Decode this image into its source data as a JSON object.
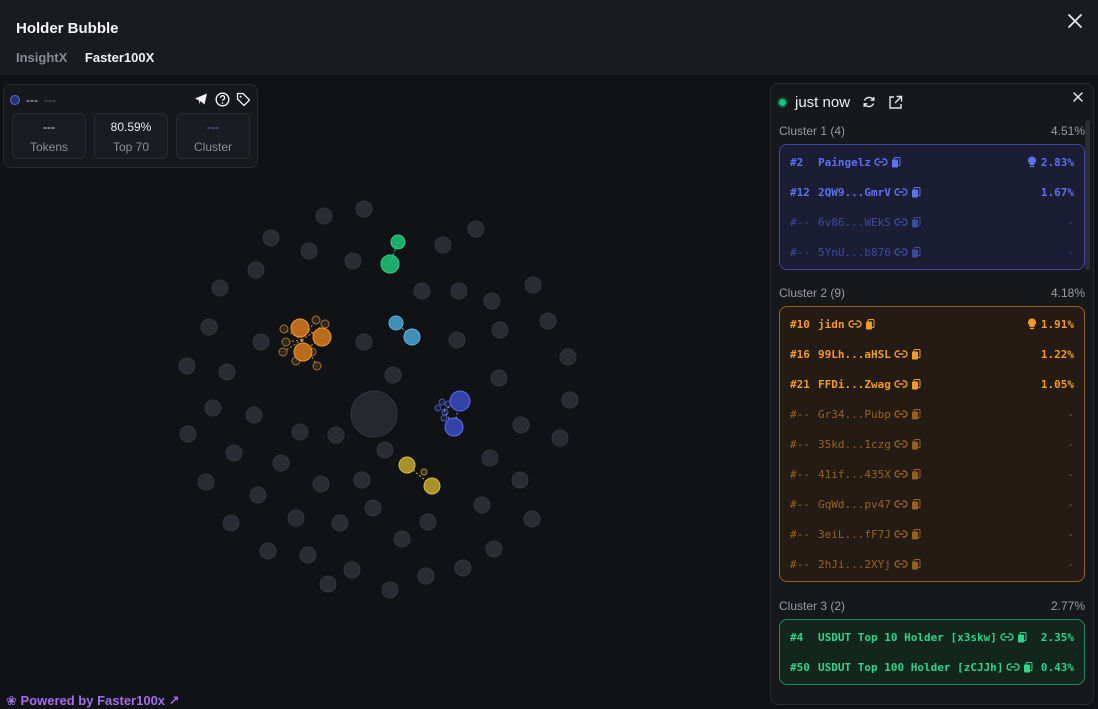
{
  "header": {
    "title": "Holder Bubble",
    "tabs": [
      {
        "label": "InsightX",
        "active": false
      },
      {
        "label": "Faster100X",
        "active": true
      }
    ]
  },
  "token": {
    "name": "---",
    "symbol": "---",
    "stats": [
      {
        "value": "---",
        "label": "Tokens"
      },
      {
        "value": "80.59%",
        "label": "Top 70"
      },
      {
        "value": "---",
        "label": "Cluster"
      }
    ]
  },
  "footer": {
    "powered_by": "Powered by Faster100x"
  },
  "panel": {
    "status": "just now"
  },
  "clusters": [
    {
      "title": "Cluster 1 (4)",
      "pct": "4.51%",
      "color": "#5b72f2",
      "border": "#3b4ba8",
      "bg": "#1a1d33",
      "rows": [
        {
          "rank": "#2",
          "name": "Paingelz",
          "pct": "2.83%",
          "bulb": true,
          "dim": false
        },
        {
          "rank": "#12",
          "name": "2QW9...GmrV",
          "pct": "1.67%",
          "bulb": false,
          "dim": false
        },
        {
          "rank": "#--",
          "name": "6v86...WEkS",
          "pct": "-",
          "bulb": false,
          "dim": true
        },
        {
          "rank": "#--",
          "name": "5YnU...b876",
          "pct": "-",
          "bulb": false,
          "dim": true
        }
      ]
    },
    {
      "title": "Cluster 2 (9)",
      "pct": "4.18%",
      "color": "#f39a2b",
      "border": "#9a5e1b",
      "bg": "#241c14",
      "rows": [
        {
          "rank": "#10",
          "name": "jidn",
          "pct": "1.91%",
          "bulb": true,
          "dim": false
        },
        {
          "rank": "#16",
          "name": "99Lh...aHSL",
          "pct": "1.22%",
          "bulb": false,
          "dim": false
        },
        {
          "rank": "#21",
          "name": "FFDi...Zwag",
          "pct": "1.05%",
          "bulb": false,
          "dim": false
        },
        {
          "rank": "#--",
          "name": "Gr34...Pubp",
          "pct": "-",
          "bulb": false,
          "dim": true
        },
        {
          "rank": "#--",
          "name": "35kd...1czg",
          "pct": "-",
          "bulb": false,
          "dim": true
        },
        {
          "rank": "#--",
          "name": "41if...435X",
          "pct": "-",
          "bulb": false,
          "dim": true
        },
        {
          "rank": "#--",
          "name": "GqWd...pv47",
          "pct": "-",
          "bulb": false,
          "dim": true
        },
        {
          "rank": "#--",
          "name": "3eiL...fF7J",
          "pct": "-",
          "bulb": false,
          "dim": true
        },
        {
          "rank": "#--",
          "name": "2hJi...2XYj",
          "pct": "-",
          "bulb": false,
          "dim": true
        }
      ]
    },
    {
      "title": "Cluster 3 (2)",
      "pct": "2.77%",
      "color": "#2bd68c",
      "border": "#1c8a5b",
      "bg": "#12261d",
      "rows": [
        {
          "rank": "#4",
          "name": "USDUT Top 10 Holder [x3skw]",
          "pct": "2.35%",
          "bulb": false,
          "dim": false
        },
        {
          "rank": "#50",
          "name": "USDUT Top 100 Holder [zCJJh]",
          "pct": "0.43%",
          "bulb": false,
          "dim": false
        }
      ]
    }
  ]
}
